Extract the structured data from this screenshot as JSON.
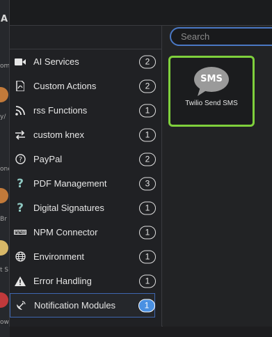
{
  "background": {
    "letter": "A",
    "fragments": [
      "om",
      "y/",
      "one",
      "Br",
      "t S",
      "ow"
    ]
  },
  "search": {
    "placeholder": "Search",
    "value": ""
  },
  "categories": [
    {
      "label": "AI Services",
      "count": "2",
      "icon": "video-camera-icon"
    },
    {
      "label": "Custom Actions",
      "count": "2",
      "icon": "pdf-file-icon"
    },
    {
      "label": "rss Functions",
      "count": "1",
      "icon": "rss-icon"
    },
    {
      "label": "custom knex",
      "count": "1",
      "icon": "swap-arrows-icon"
    },
    {
      "label": "PayPal",
      "count": "2",
      "icon": "question-circle-icon"
    },
    {
      "label": "PDF Management",
      "count": "3",
      "icon": "question-icon"
    },
    {
      "label": "Digital Signatures",
      "count": "1",
      "icon": "question-icon"
    },
    {
      "label": "NPM Connector",
      "count": "1",
      "icon": "npm-icon"
    },
    {
      "label": "Environment",
      "count": "1",
      "icon": "globe-icon"
    },
    {
      "label": "Error Handling",
      "count": "1",
      "icon": "warning-icon"
    },
    {
      "label": "Notification Modules",
      "count": "1",
      "icon": "satellite-dish-icon",
      "selected": true
    }
  ],
  "module": {
    "label": "Twilio Send SMS",
    "icon_text": "SMS",
    "icon": "sms-bubble-icon"
  },
  "colors": {
    "accent": "#4a90e2",
    "module_border": "#7fd03c"
  }
}
